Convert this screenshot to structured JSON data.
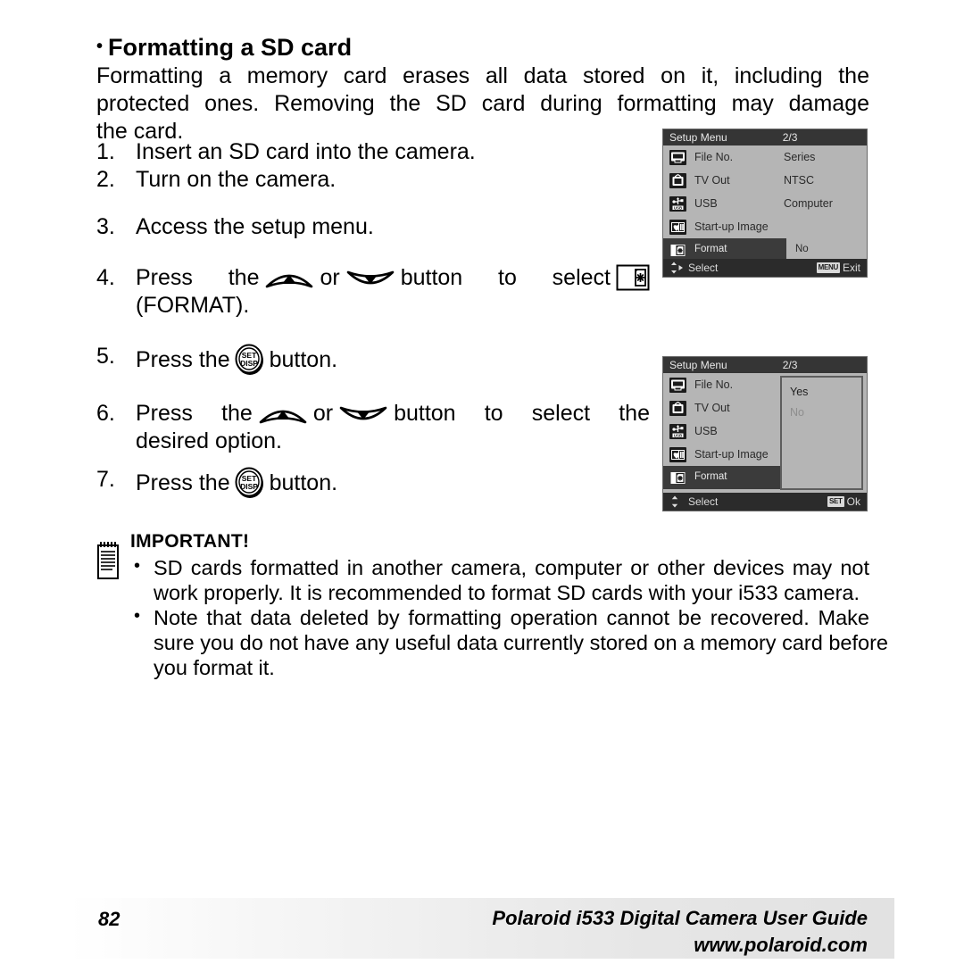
{
  "heading": {
    "bullet": "•",
    "text": "Formatting a SD card"
  },
  "intro": {
    "line1": "Formatting a memory card erases all data stored on it, including the",
    "line2": "protected ones. Removing the SD card during formatting may damage",
    "line3": "the card."
  },
  "steps": [
    {
      "num": "1.",
      "text": "Insert an SD card into the camera."
    },
    {
      "num": "2.",
      "text": "Turn on the camera."
    },
    {
      "num": "3.",
      "text": "Access the setup menu."
    },
    {
      "num": "4.",
      "part1": "Press the",
      "part2": "or",
      "part3": "button to select",
      "line2": "(FORMAT)."
    },
    {
      "num": "5.",
      "part1": "Press the",
      "part2": "button."
    },
    {
      "num": "6.",
      "part1": "Press the",
      "part2": "or",
      "part3": "button to select the",
      "line2": "desired option."
    },
    {
      "num": "7.",
      "part1": "Press the",
      "part2": "button."
    }
  ],
  "icons": {
    "up_button": "up-arc-button-icon",
    "down_button": "down-arc-button-icon",
    "set_disp_button": "set-disp-button-icon",
    "set_label_top": "SET",
    "set_label_bottom": "DISP",
    "format_glyph": "format-card-asterisk-icon",
    "memo_note": "memo-notepad-icon"
  },
  "important": {
    "title": "IMPORTANT!",
    "bullet": "•",
    "items": [
      {
        "line1": "SD cards formatted in another camera, computer or other devices may not",
        "line2": "work properly. It is recommended to format SD cards with your i533 camera."
      },
      {
        "line1": "Note that data deleted by formatting operation cannot be recovered. Make",
        "line2": "sure you do not have any useful data currently stored on a memory card before",
        "line3": "you format it."
      }
    ]
  },
  "lcd_menu_1": {
    "title": "Setup Menu",
    "page": "2/3",
    "rows": [
      {
        "icon": "file-no-icon",
        "label": "File No.",
        "value": "Series"
      },
      {
        "icon": "tv-out-icon",
        "label": "TV Out",
        "value": "NTSC"
      },
      {
        "icon": "usb-icon",
        "label": "USB",
        "value": "Computer"
      },
      {
        "icon": "start-up-image-icon",
        "label": "Start-up Image",
        "value": ""
      }
    ],
    "selected_row": {
      "icon": "format-icon",
      "label": "Format",
      "value": "No"
    },
    "footer": {
      "nav_icon": "up-down-right-arrows-icon",
      "nav_label": "Select",
      "badge": "MENU",
      "action_label": "Exit"
    }
  },
  "lcd_menu_2": {
    "title": "Setup Menu",
    "page": "2/3",
    "rows": [
      {
        "icon": "file-no-icon",
        "label": "File No."
      },
      {
        "icon": "tv-out-icon",
        "label": "TV Out"
      },
      {
        "icon": "usb-icon",
        "label": "USB"
      },
      {
        "icon": "start-up-image-icon",
        "label": "Start-up Image"
      }
    ],
    "selected_row": {
      "icon": "format-icon",
      "label": "Format"
    },
    "submenu": {
      "options": [
        {
          "label": "Yes",
          "state": "active"
        },
        {
          "label": "No",
          "state": "dimmed"
        }
      ]
    },
    "footer": {
      "nav_icon": "up-down-arrows-icon",
      "nav_label": "Select",
      "badge": "SET",
      "action_label": "Ok"
    }
  },
  "footer": {
    "page_number": "82",
    "line1": "Polaroid i533 Digital Camera User Guide",
    "line2": "www.polaroid.com"
  },
  "colors": {
    "lcd_panel": "#b5b5b5",
    "lcd_header": "#353535",
    "lcd_footer": "#2b2b2b",
    "lcd_highlight": "#3b3b3b",
    "text": "#000000"
  }
}
